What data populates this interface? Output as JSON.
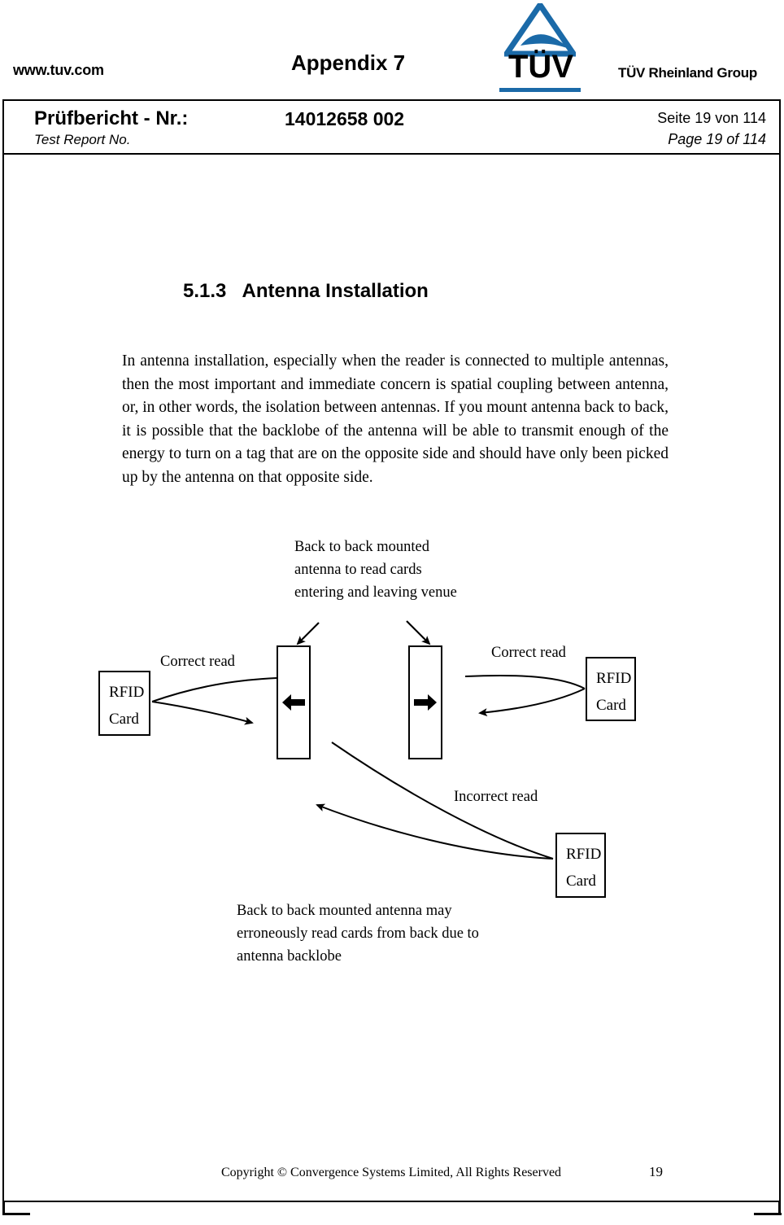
{
  "banner": {
    "url": "www.tuv.com",
    "appendix_title": "Appendix 7",
    "logo_word": "TÜV",
    "group_text": "TÜV Rheinland Group"
  },
  "header": {
    "report_label_de": "Prüfbericht - Nr.:",
    "report_label_en": "Test Report No.",
    "report_number": "14012658 002",
    "page_de": "Seite 19 von 114",
    "page_en": "Page 19 of 114"
  },
  "content": {
    "section_number": "5.1.3",
    "section_title": "Antenna Installation",
    "heading_full": "5.1.3   Antenna Installation",
    "paragraph": "In antenna installation, especially when the reader is connected to multiple antennas, then the most important and immediate concern is spatial coupling between antenna, or, in other words, the isolation between antennas.   If you mount antenna back to back, it is possible that the backlobe of the antenna will be able to transmit enough of the energy to turn on a tag that are on the opposite side and should have only been picked up by the antenna on that opposite side."
  },
  "figure": {
    "top_caption": "Back to back mounted\nantenna to read cards\nentering and leaving venue",
    "bottom_caption": "Back to back mounted antenna may\nerroneously read cards from back due to\nantenna backlobe",
    "label_correct_left": "Correct read",
    "label_correct_right": "Correct read",
    "label_incorrect": "Incorrect read",
    "card_left_line1": "RFID",
    "card_left_line2": "Card",
    "card_right_line1": "RFID",
    "card_right_line2": "Card",
    "card_bottom_line1": "RFID",
    "card_bottom_line2": "Card"
  },
  "footer": {
    "copyright": "Copyright © Convergence Systems Limited, All Rights Reserved",
    "page_number": "19"
  },
  "colors": {
    "logo_blue": "#1b6aa8",
    "ink": "#000000",
    "paper": "#ffffff"
  }
}
